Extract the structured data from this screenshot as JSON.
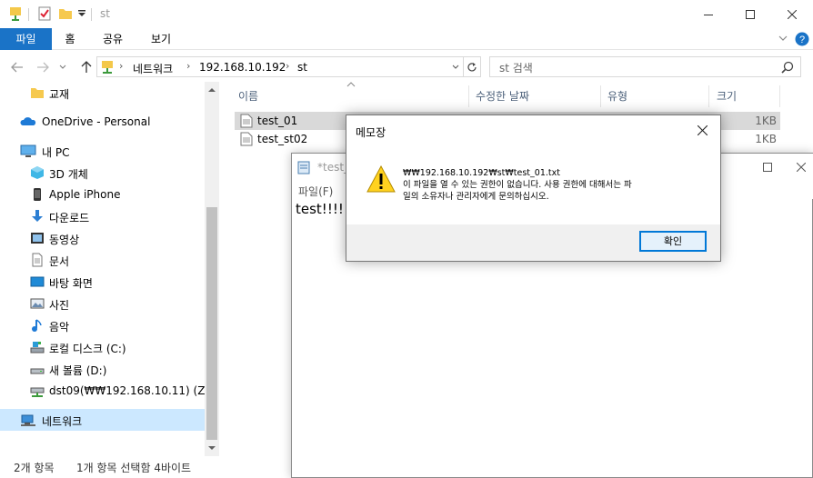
{
  "explorer": {
    "title": "st",
    "ribbon_tabs": [
      "파일",
      "홈",
      "공유",
      "보기"
    ],
    "address": [
      "네트워크",
      "192.168.10.192",
      "st"
    ],
    "search_placeholder": "st 검색",
    "nav_items": [
      {
        "label": "교재",
        "icon": "folder-icon"
      },
      {
        "label": "OneDrive - Personal",
        "icon": "onedrive-cloud-icon"
      },
      {
        "label": "내 PC",
        "icon": "pc-icon"
      },
      {
        "label": "3D 개체",
        "icon": "3d-objects-icon"
      },
      {
        "label": "Apple iPhone",
        "icon": "iphone-icon"
      },
      {
        "label": "다운로드",
        "icon": "download-icon"
      },
      {
        "label": "동영상",
        "icon": "video-icon"
      },
      {
        "label": "문서",
        "icon": "document-icon"
      },
      {
        "label": "바탕 화면",
        "icon": "desktop-icon"
      },
      {
        "label": "사진",
        "icon": "pictures-icon"
      },
      {
        "label": "음악",
        "icon": "music-icon"
      },
      {
        "label": "로컬 디스크 (C:)",
        "icon": "local-disk-icon"
      },
      {
        "label": "새 볼륨 (D:)",
        "icon": "drive-icon"
      },
      {
        "label": "dst09(₩₩192.168.10.11) (Z:)",
        "icon": "network-drive-icon"
      },
      {
        "label": "네트워크",
        "icon": "network-icon"
      }
    ],
    "columns": {
      "name": "이름",
      "modified": "수정한 날짜",
      "type": "유형",
      "size": "크기"
    },
    "files": [
      {
        "name": "test_01",
        "size": "1KB"
      },
      {
        "name": "test_st02",
        "size": "1KB"
      }
    ],
    "status": {
      "count": "2개 항목",
      "selected": "1개 항목 선택함 4바이트"
    }
  },
  "notepad": {
    "title": "*test_(",
    "menu_file": "파일(F)",
    "content": "test!!!!"
  },
  "dialog": {
    "title": "메모장",
    "message": "₩₩192.168.10.192₩st₩test_01.txt\n이 파일을 열 수 있는 권한이 없습니다. 사용 권한에 대해서는 파\n일의 소유자나 관리자에게 문의하십시오.",
    "ok_label": "확인"
  }
}
